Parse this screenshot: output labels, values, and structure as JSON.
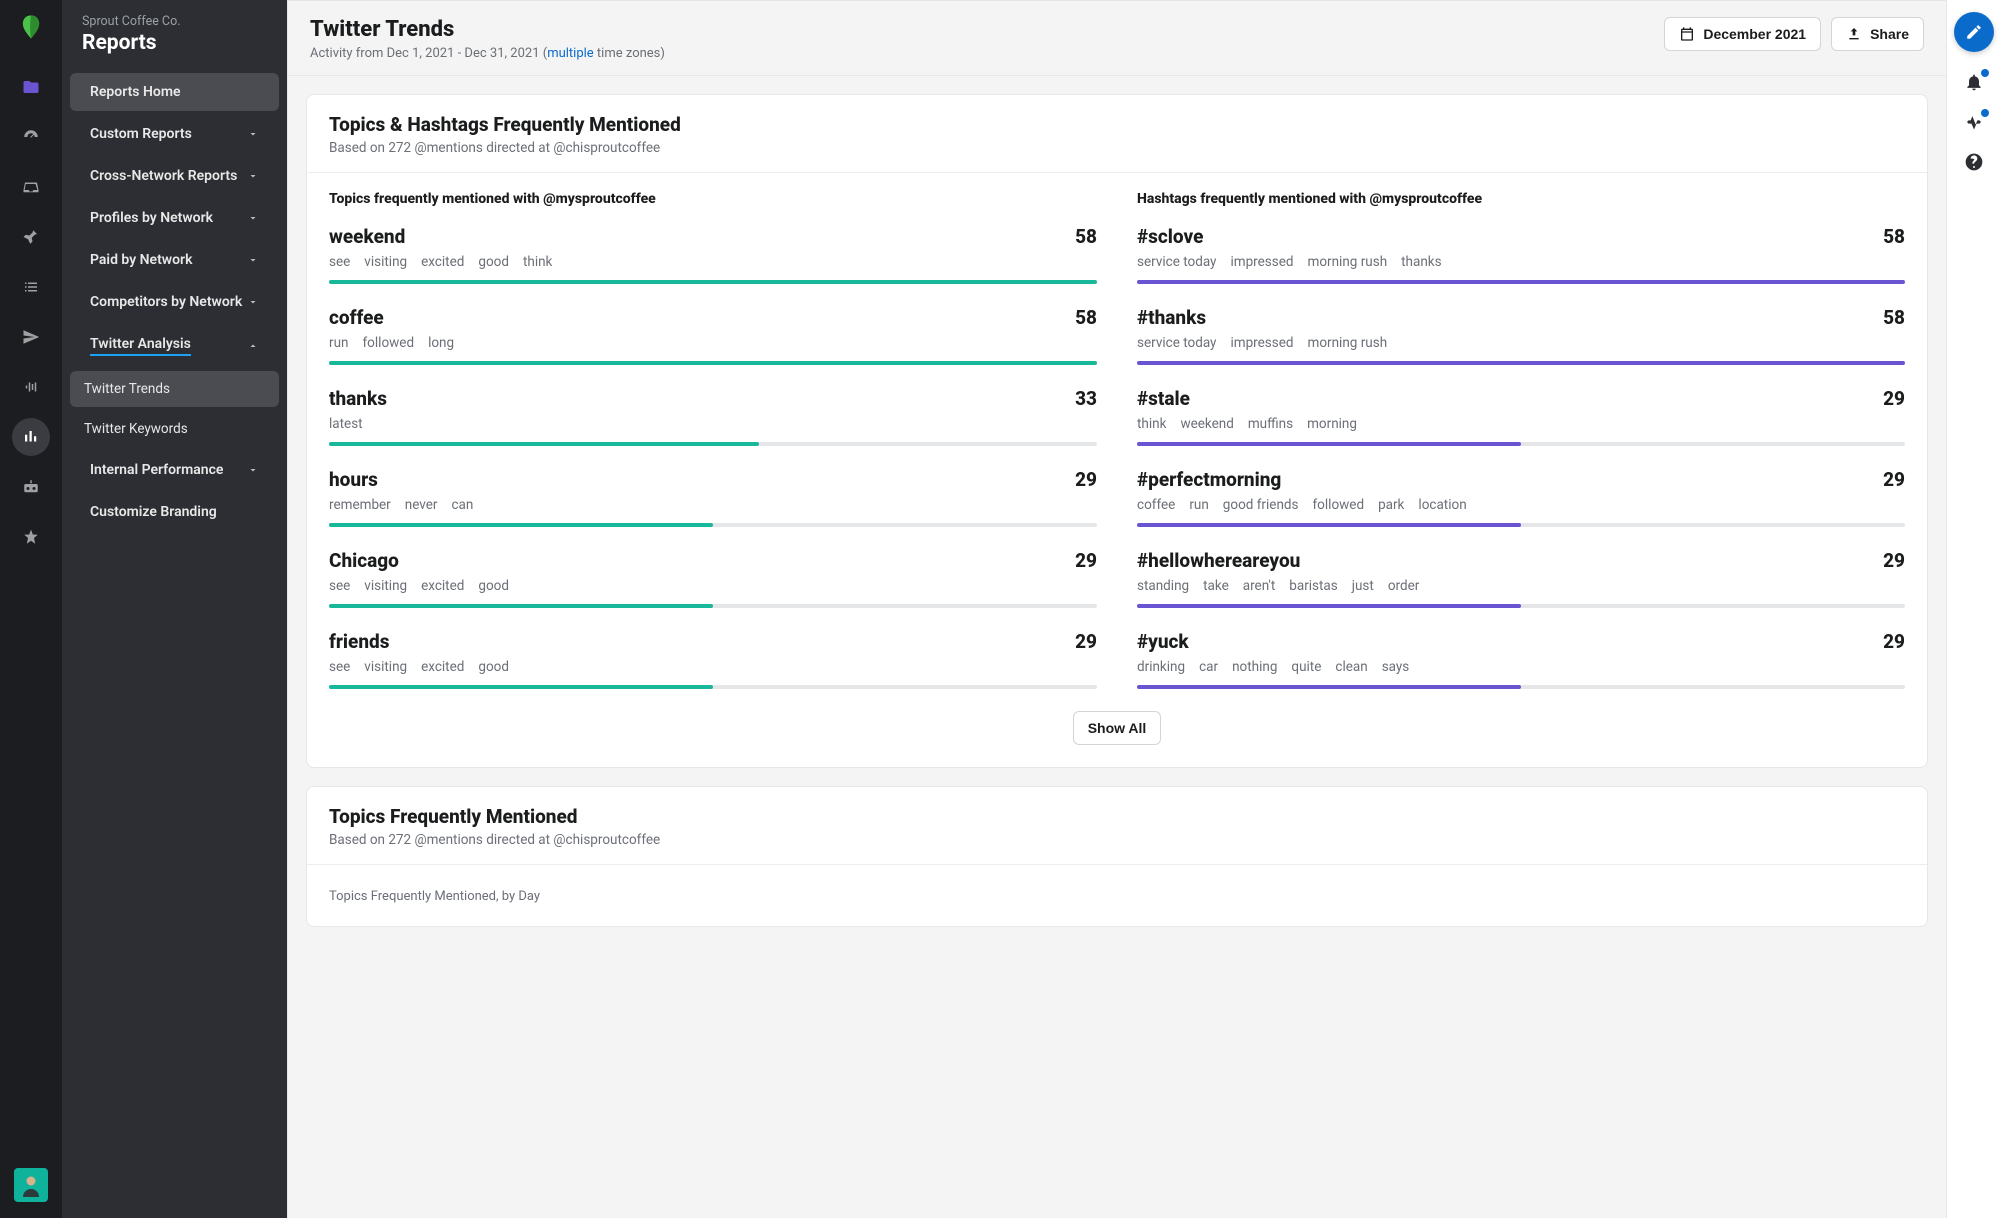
{
  "sidebar": {
    "org": "Sprout Coffee Co.",
    "section": "Reports",
    "items": [
      {
        "label": "Reports Home",
        "selected": true,
        "expandable": false
      },
      {
        "label": "Custom Reports",
        "expandable": true
      },
      {
        "label": "Cross-Network Reports",
        "expandable": true
      },
      {
        "label": "Profiles by Network",
        "expandable": true
      },
      {
        "label": "Paid by Network",
        "expandable": true
      },
      {
        "label": "Competitors by Network",
        "expandable": true
      },
      {
        "label": "Twitter Analysis",
        "expandable": true,
        "open": true,
        "children": [
          {
            "label": "Twitter Trends",
            "selected": true
          },
          {
            "label": "Twitter Keywords"
          }
        ]
      },
      {
        "label": "Internal Performance",
        "expandable": true
      },
      {
        "label": "Customize Branding",
        "expandable": false
      }
    ]
  },
  "header": {
    "title": "Twitter Trends",
    "activity_prefix": "Activity from Dec 1, 2021 - Dec 31, 2021 (",
    "activity_link": "multiple",
    "activity_suffix": " time zones)",
    "date_button": "December 2021",
    "share_button": "Share"
  },
  "card1": {
    "title": "Topics & Hashtags Frequently Mentioned",
    "subtitle": "Based on 272 @mentions directed at @chisproutcoffee",
    "left_title": "Topics frequently mentioned with @mysproutcoffee",
    "right_title": "Hashtags frequently mentioned with @mysproutcoffee",
    "show_all": "Show All"
  },
  "card2": {
    "title": "Topics Frequently Mentioned",
    "subtitle": "Based on 272 @mentions directed at @chisproutcoffee",
    "chart_title": "Topics Frequently Mentioned, by Day"
  },
  "chart_data": {
    "type": "bar",
    "note": "Two horizontal bar lists; values are mention counts. Bar fill percent estimated from max=58.",
    "topics": {
      "max": 58,
      "color": "#18b99a",
      "series": [
        {
          "name": "weekend",
          "value": 58,
          "pct": 100,
          "words": [
            "see",
            "visiting",
            "excited",
            "good",
            "think"
          ]
        },
        {
          "name": "coffee",
          "value": 58,
          "pct": 100,
          "words": [
            "run",
            "followed",
            "long"
          ]
        },
        {
          "name": "thanks",
          "value": 33,
          "pct": 56,
          "words": [
            "latest"
          ]
        },
        {
          "name": "hours",
          "value": 29,
          "pct": 50,
          "words": [
            "remember",
            "never",
            "can"
          ]
        },
        {
          "name": "Chicago",
          "value": 29,
          "pct": 50,
          "words": [
            "see",
            "visiting",
            "excited",
            "good"
          ]
        },
        {
          "name": "friends",
          "value": 29,
          "pct": 50,
          "words": [
            "see",
            "visiting",
            "excited",
            "good"
          ]
        }
      ]
    },
    "hashtags": {
      "max": 58,
      "color": "#6a54d1",
      "series": [
        {
          "name": "#sclove",
          "value": 58,
          "pct": 100,
          "words": [
            "service today",
            "impressed",
            "morning rush",
            "thanks"
          ]
        },
        {
          "name": "#thanks",
          "value": 58,
          "pct": 100,
          "words": [
            "service today",
            "impressed",
            "morning rush"
          ]
        },
        {
          "name": "#stale",
          "value": 29,
          "pct": 50,
          "words": [
            "think",
            "weekend",
            "muffins",
            "morning"
          ]
        },
        {
          "name": "#perfectmorning",
          "value": 29,
          "pct": 50,
          "words": [
            "coffee",
            "run",
            "good friends",
            "followed",
            "park",
            "location"
          ]
        },
        {
          "name": "#hellowhereareyou",
          "value": 29,
          "pct": 50,
          "words": [
            "standing",
            "take",
            "aren't",
            "baristas",
            "just",
            "order"
          ]
        },
        {
          "name": "#yuck",
          "value": 29,
          "pct": 50,
          "words": [
            "drinking",
            "car",
            "nothing",
            "quite",
            "clean",
            "says"
          ]
        }
      ]
    }
  }
}
